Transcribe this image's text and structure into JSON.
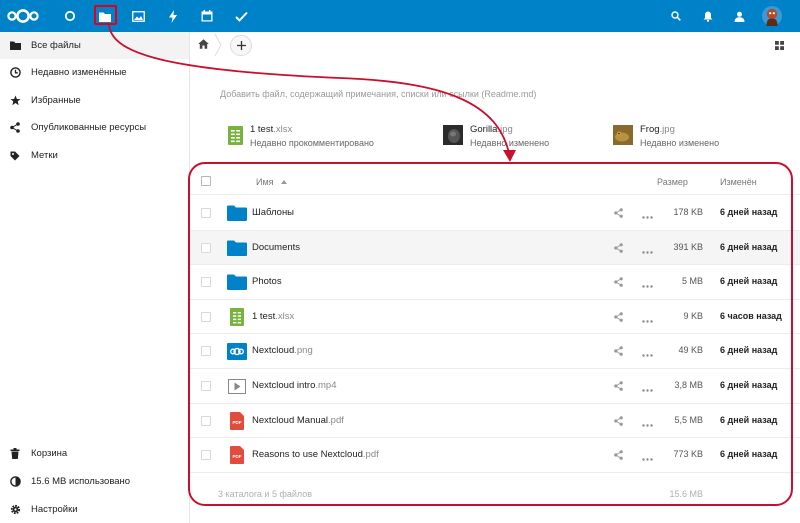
{
  "header": {
    "icons": [
      "logo-icon",
      "dashboard-icon",
      "files-icon",
      "photos-icon",
      "activity-icon",
      "calendar-icon",
      "tasks-icon",
      "search-icon",
      "notifications-icon",
      "contacts-icon",
      "avatar"
    ]
  },
  "sidebar": {
    "items": [
      {
        "label": "Все файлы",
        "icon": "folder-icon"
      },
      {
        "label": "Недавно изменённые",
        "icon": "clock-icon"
      },
      {
        "label": "Избранные",
        "icon": "star-icon"
      },
      {
        "label": "Опубликованные ресурсы",
        "icon": "share-icon"
      },
      {
        "label": "Метки",
        "icon": "tag-icon"
      }
    ],
    "bottom": [
      {
        "label": "Корзина",
        "icon": "trash-icon"
      },
      {
        "label": "15.6 MB использовано",
        "icon": "quota-icon"
      },
      {
        "label": "Настройки",
        "icon": "gear-icon"
      }
    ]
  },
  "readme_placeholder": "Добавить файл, содержащий примечания, списки или ссылки (Readme.md)",
  "recent": [
    {
      "name": "1 test",
      "ext": ".xlsx",
      "sub": "Недавно прокомментировано"
    },
    {
      "name": "Gorilla",
      "ext": ".jpg",
      "sub": "Недавно изменено"
    },
    {
      "name": "Frog",
      "ext": ".jpg",
      "sub": "Недавно изменено"
    }
  ],
  "table": {
    "col_name": "Имя",
    "col_size": "Размер",
    "col_modified": "Изменён",
    "rows": [
      {
        "name": "Шаблоны",
        "ext": "",
        "type": "folder",
        "size": "178 KB",
        "modified": "6 дней назад"
      },
      {
        "name": "Documents",
        "ext": "",
        "type": "folder",
        "size": "391 KB",
        "modified": "6 дней назад"
      },
      {
        "name": "Photos",
        "ext": "",
        "type": "folder",
        "size": "5 MB",
        "modified": "6 дней назад"
      },
      {
        "name": "1 test",
        "ext": ".xlsx",
        "type": "spreadsheet",
        "size": "9 KB",
        "modified": "6 часов назад"
      },
      {
        "name": "Nextcloud",
        "ext": ".png",
        "type": "image",
        "size": "49 KB",
        "modified": "6 дней назад"
      },
      {
        "name": "Nextcloud intro",
        "ext": ".mp4",
        "type": "video",
        "size": "3,8 MB",
        "modified": "6 дней назад"
      },
      {
        "name": "Nextcloud Manual",
        "ext": ".pdf",
        "type": "pdf",
        "size": "5,5 MB",
        "modified": "6 дней назад"
      },
      {
        "name": "Reasons to use Nextcloud",
        "ext": ".pdf",
        "type": "pdf",
        "size": "773 KB",
        "modified": "6 дней назад"
      }
    ],
    "summary": "3 каталога и 5 файлов",
    "summary_size": "15.6 MB"
  },
  "colors": {
    "brand": "#0082c9",
    "annotation": "#c8102e",
    "spreadsheet": "#77b33d",
    "pdf": "#e24c3c"
  }
}
